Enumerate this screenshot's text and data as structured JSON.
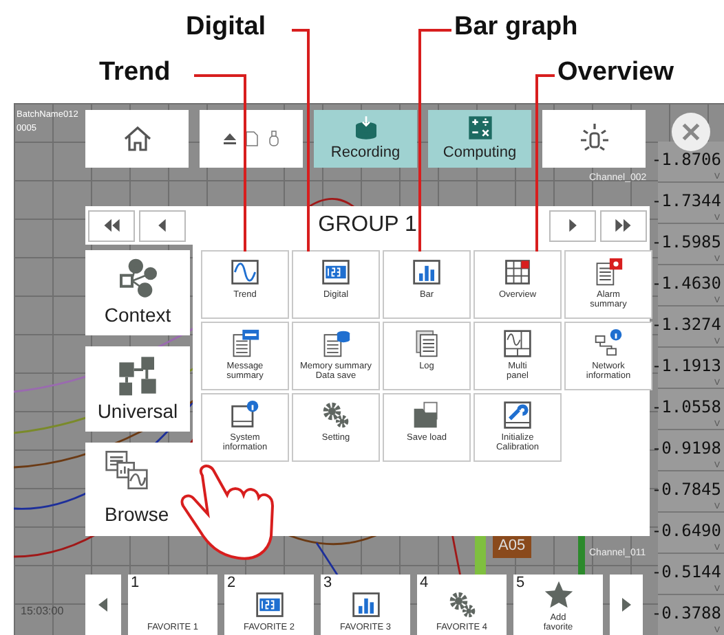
{
  "callouts": [
    {
      "label": "Digital"
    },
    {
      "label": "Bar graph"
    },
    {
      "label": "Trend"
    },
    {
      "label": "Overview"
    }
  ],
  "screen": {
    "batch_name": "BatchName012",
    "batch_number": "0005",
    "time_label": "15:03:00",
    "channel_labels": [
      "Channel_002",
      "Channel_011"
    ],
    "tag": "A05",
    "readings": [
      {
        "value": "-1.8706",
        "unit": "V"
      },
      {
        "value": "-1.7344",
        "unit": "V"
      },
      {
        "value": "-1.5985",
        "unit": "V"
      },
      {
        "value": "-1.4630",
        "unit": "V"
      },
      {
        "value": "-1.3274",
        "unit": "V"
      },
      {
        "value": "-1.1913",
        "unit": "V"
      },
      {
        "value": "-1.0558",
        "unit": "V"
      },
      {
        "value": "-0.9198",
        "unit": "V"
      },
      {
        "value": "-0.7845",
        "unit": "V"
      },
      {
        "value": "-0.6490",
        "unit": "V"
      },
      {
        "value": "-0.5144",
        "unit": "V"
      },
      {
        "value": "-0.3788",
        "unit": "V"
      }
    ]
  },
  "toolbar": [
    {
      "kind": "home",
      "highlighted": false
    },
    {
      "kind": "media",
      "highlighted": false
    },
    {
      "kind": "recording",
      "label": "Recording",
      "highlighted": true
    },
    {
      "kind": "computing",
      "label": "Computing",
      "highlighted": true
    },
    {
      "kind": "lamp",
      "highlighted": false
    }
  ],
  "group_bar": {
    "title": "GROUP  1"
  },
  "side_buttons": [
    {
      "kind": "context",
      "label": "Context"
    },
    {
      "kind": "universal",
      "label": "Universal"
    },
    {
      "kind": "browse",
      "label": "Browse"
    }
  ],
  "menu_tiles": [
    {
      "kind": "trend",
      "label": "Trend"
    },
    {
      "kind": "digital",
      "label": "Digital"
    },
    {
      "kind": "bar",
      "label": "Bar"
    },
    {
      "kind": "overview",
      "label": "Overview"
    },
    {
      "kind": "alarm",
      "label": "Alarm\nsummary"
    },
    {
      "kind": "message",
      "label": "Message\nsummary"
    },
    {
      "kind": "memory",
      "label": "Memory  summary\nData  save"
    },
    {
      "kind": "log",
      "label": "Log"
    },
    {
      "kind": "multi",
      "label": "Multi\npanel"
    },
    {
      "kind": "network",
      "label": "Network\ninformation"
    },
    {
      "kind": "sysinfo",
      "label": "System\ninformation"
    },
    {
      "kind": "setting",
      "label": "Setting"
    },
    {
      "kind": "saveload",
      "label": "Save  load"
    },
    {
      "kind": "calibration",
      "label": "Initialize\nCalibration"
    }
  ],
  "favorites": [
    {
      "number": "1",
      "kind": "none",
      "label": "FAVORITE  1"
    },
    {
      "number": "2",
      "kind": "digital",
      "label": "FAVORITE  2"
    },
    {
      "number": "3",
      "kind": "bar",
      "label": "FAVORITE  3"
    },
    {
      "number": "4",
      "kind": "setting",
      "label": "FAVORITE  4"
    },
    {
      "number": "5",
      "kind": "star",
      "label": "Add\nfavorite"
    }
  ]
}
